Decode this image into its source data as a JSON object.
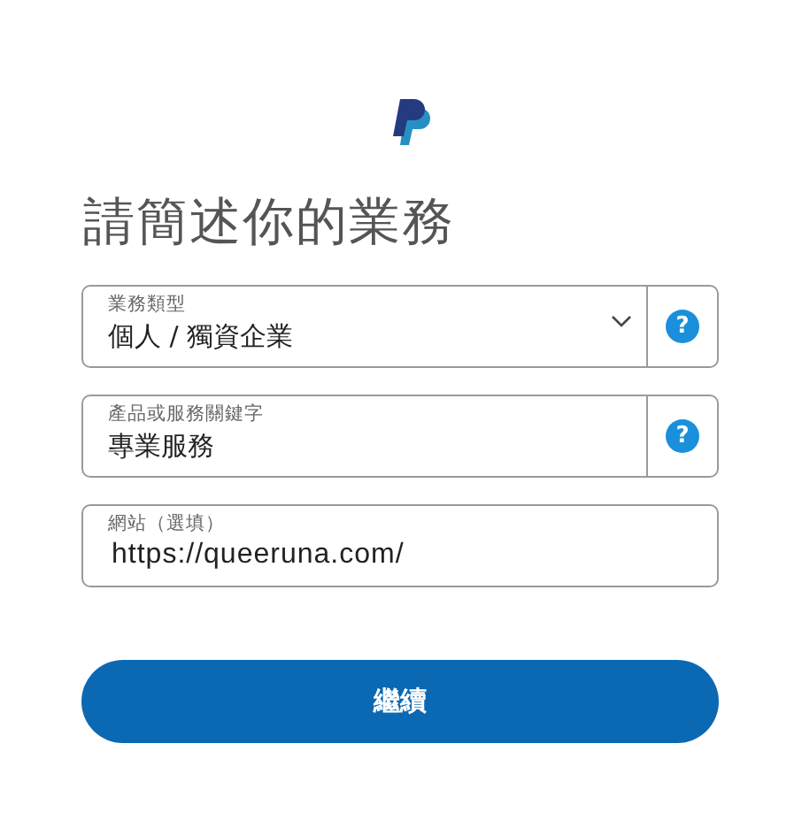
{
  "title": "請簡述你的業務",
  "fields": [
    {
      "kind": "select",
      "label": "業務類型",
      "value": "個人 / 獨資企業",
      "help": "?"
    },
    {
      "kind": "text",
      "label": "產品或服務關鍵字",
      "value": "專業服務",
      "help": "?"
    },
    {
      "kind": "text",
      "label": "網站（選填）",
      "value": "https://queeruna.com/"
    }
  ],
  "button": "繼續"
}
